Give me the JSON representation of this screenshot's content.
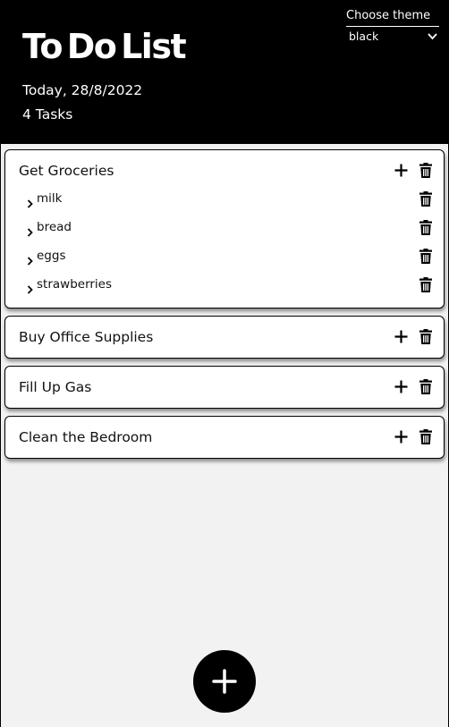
{
  "header": {
    "title": "To Do List",
    "date": "Today, 28/8/2022",
    "task_count": "4 Tasks",
    "theme_label": "Choose theme",
    "theme_value": "black"
  },
  "tasks": [
    {
      "title": "Get Groceries",
      "subtasks": [
        "milk",
        "bread",
        "eggs",
        "strawberries"
      ]
    },
    {
      "title": "Buy Office Supplies",
      "subtasks": []
    },
    {
      "title": "Fill Up Gas",
      "subtasks": []
    },
    {
      "title": "Clean the Bedroom",
      "subtasks": []
    }
  ],
  "icons": {
    "add_task": "plus-icon",
    "delete": "trash-icon",
    "expand": "chevron-right-icon",
    "fab": "plus-icon",
    "theme_select": "chevron-down-icon"
  },
  "colors": {
    "header_bg": "#000000",
    "page_bg": "#f2f2f2",
    "card_bg": "#ffffff",
    "fab_bg": "#000000"
  }
}
